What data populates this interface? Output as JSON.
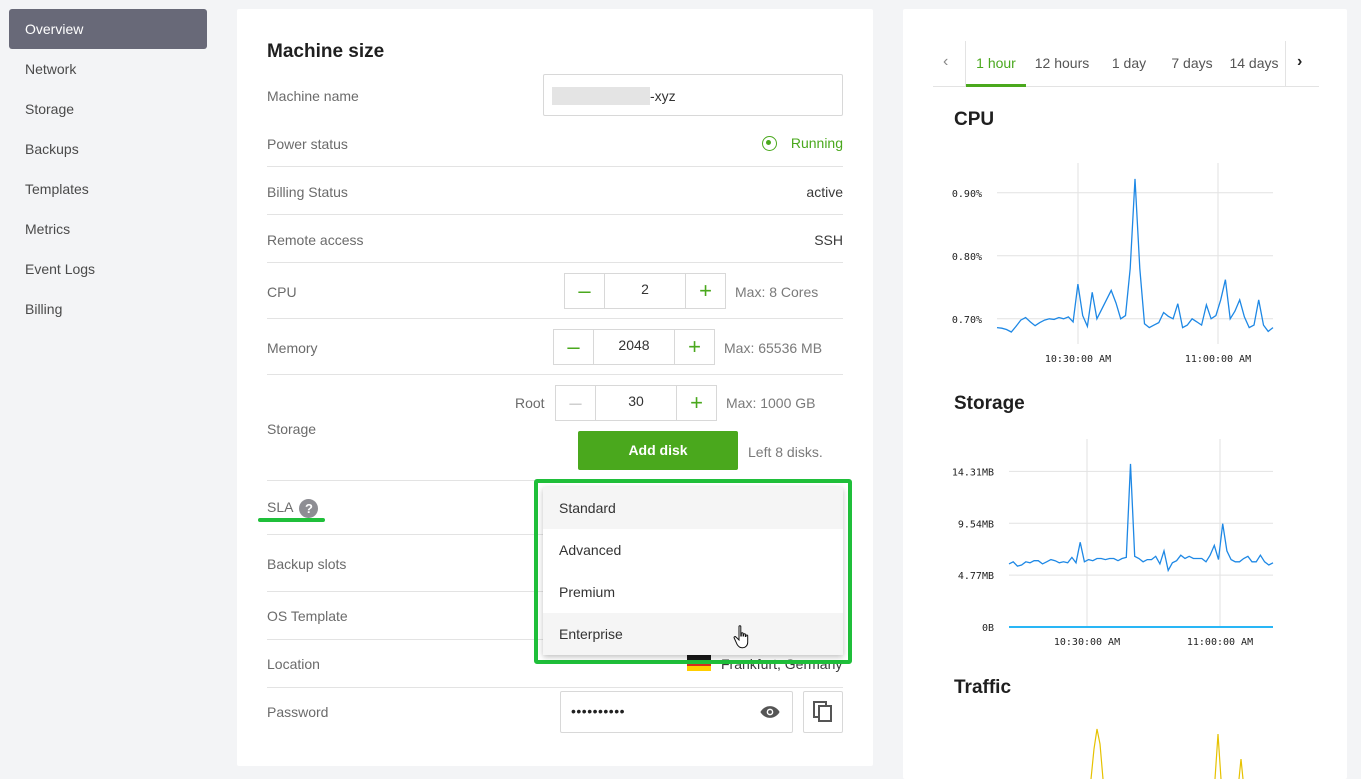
{
  "sidebar": {
    "items": [
      {
        "label": "Overview",
        "active": true
      },
      {
        "label": "Network"
      },
      {
        "label": "Storage"
      },
      {
        "label": "Backups"
      },
      {
        "label": "Templates"
      },
      {
        "label": "Metrics"
      },
      {
        "label": "Event Logs"
      },
      {
        "label": "Billing"
      }
    ]
  },
  "machine": {
    "title": "Machine size",
    "name_label": "Machine name",
    "name_suffix": "-xyz",
    "power_label": "Power status",
    "power_value": "Running",
    "billing_label": "Billing Status",
    "billing_value": "active",
    "remote_label": "Remote access",
    "remote_value": "SSH",
    "cpu_label": "CPU",
    "cpu_value": "2",
    "cpu_max": "Max: 8 Cores",
    "memory_label": "Memory",
    "memory_value": "2048",
    "memory_max": "Max: 65536 MB",
    "storage_label": "Storage",
    "root_label": "Root",
    "root_value": "30",
    "root_max": "Max: 1000 GB",
    "add_disk_label": "Add disk",
    "disks_left": "Left 8 disks.",
    "sla_label": "SLA",
    "sla_help": "?",
    "backup_label": "Backup slots",
    "os_label": "OS Template",
    "location_label": "Location",
    "location_value": "Frankfurt, Germany",
    "password_label": "Password",
    "password_value": "••••••••••"
  },
  "sla_dropdown": {
    "options": [
      "Standard",
      "Advanced",
      "Premium",
      "Enterprise"
    ],
    "hovered": "Enterprise"
  },
  "metrics": {
    "tabs": [
      "1 hour",
      "12 hours",
      "1 day",
      "7 days",
      "14 days"
    ],
    "active_tab": "1 hour",
    "cpu_title": "CPU",
    "storage_title": "Storage",
    "traffic_title": "Traffic"
  },
  "chart_data": [
    {
      "type": "line",
      "title": "CPU",
      "yticks": [
        "0.90%",
        "0.80%",
        "0.70%"
      ],
      "ytick_values": [
        0.9,
        0.8,
        0.7
      ],
      "xticks": [
        "10:30:00 AM",
        "11:00:00 AM"
      ],
      "ylim": [
        0.66,
        0.925
      ],
      "grid": true,
      "series": [
        {
          "color": "#1e88e5",
          "values": [
            0.686,
            0.685,
            0.683,
            0.679,
            0.688,
            0.698,
            0.702,
            0.695,
            0.689,
            0.694,
            0.698,
            0.7,
            0.699,
            0.702,
            0.7,
            0.703,
            0.695,
            0.755,
            0.705,
            0.688,
            0.742,
            0.7,
            0.715,
            0.73,
            0.745,
            0.725,
            0.7,
            0.705,
            0.78,
            0.922,
            0.78,
            0.692,
            0.686,
            0.69,
            0.694,
            0.71,
            0.704,
            0.7,
            0.724,
            0.686,
            0.69,
            0.7,
            0.695,
            0.69,
            0.722,
            0.7,
            0.705,
            0.73,
            0.762,
            0.7,
            0.712,
            0.73,
            0.703,
            0.686,
            0.69,
            0.73,
            0.69,
            0.68,
            0.686
          ]
        }
      ]
    },
    {
      "type": "line",
      "title": "Storage",
      "yticks": [
        "14.31MB",
        "9.54MB",
        "4.77MB",
        "0B"
      ],
      "ytick_values": [
        14.31,
        9.54,
        4.77,
        0
      ],
      "xticks": [
        "10:30:00 AM",
        "11:00:00 AM"
      ],
      "ylim": [
        0,
        16
      ],
      "grid": true,
      "series": [
        {
          "color": "#1e88e5",
          "values": [
            5.8,
            6.0,
            5.6,
            5.7,
            6.0,
            5.9,
            6.1,
            6.1,
            5.8,
            6.0,
            6.2,
            6.1,
            5.9,
            6.0,
            5.9,
            6.4,
            5.9,
            7.8,
            6.0,
            6.2,
            6.1,
            6.3,
            6.3,
            6.2,
            6.3,
            6.3,
            6.1,
            6.3,
            6.4,
            15.0,
            6.5,
            6.3,
            6.0,
            6.2,
            6.2,
            6.5,
            5.8,
            7.0,
            5.2,
            5.9,
            6.1,
            6.6,
            6.3,
            6.5,
            6.3,
            6.3,
            6.3,
            6.0,
            6.6,
            7.5,
            6.2,
            9.5,
            7.0,
            6.2,
            6.0,
            6.0,
            6.3,
            6.5,
            6.0,
            6.0,
            6.6,
            6.0,
            5.7,
            5.9
          ]
        },
        {
          "color": "#29b6f6",
          "values": [
            0,
            0
          ]
        }
      ]
    }
  ]
}
